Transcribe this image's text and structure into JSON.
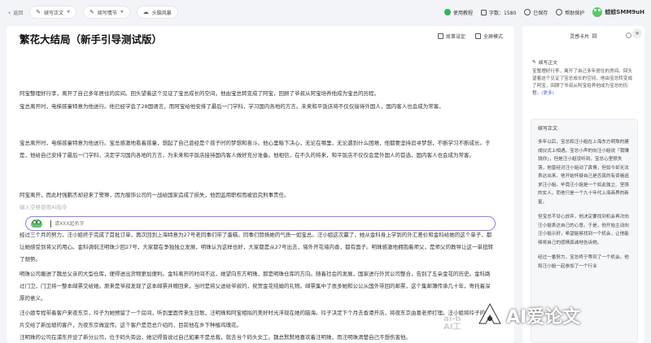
{
  "topbar": {
    "back_label": "返回",
    "pills": [
      "续写正文",
      "续写情节",
      "头脑风暴"
    ],
    "usage_label": "使用教程",
    "word_count": "字数：1580",
    "saved_label": "已保存",
    "account_label": "帮助保护",
    "username": "蛙蛙SMM9uH"
  },
  "editor": {
    "story_setting_label": "故事设定",
    "fullscreen_label": "全屏模式",
    "title": "繁花大结局（新手引导测试版）",
    "paragraphs": [
      "阿宝整理好行李，离开了自己多年居住的房间。回头望着这个见证了宝总成长的空间，他由宝总转变成了阿宝，回顾了爷叔从阿宝培养他成为宝总的历程。",
      "宝总离开时，电梯孩童特意为他送行。他已经学会了28国语言，而阿宝给他安排了最后一门学科，学习国内各地的方言。未来和平饭店将不仅仅接待外国人，国内客人也会成为常客。",
      "宝总离开时，电梯孩童特意为他送行。宝总感激地看着孩童，想起了自己曾经是个孩子时的梦想和奋斗。他心里暗下决心，无论在哪里，无论遇到什么困难，他都要坚持追寻梦想，不断学习不断成长。于是，他给自己安排了最后一门学科，决定学习国内各地的方言，为未来和平饭店接待国内客人做好充分准备。他相信，在不久的将来，和平饭店不仅仅会是外国人的首选，国内客人也会成为常客。",
      "阿宝离开，而此时强鹏杰却迎来了警察，因为服饰公司的一战给国家造成了损失，他因监用职权而被追究刑事责任。"
    ],
    "ai_placeholder_line": "输入空格使用AI指令",
    "ai_input_placeholder": "请XXX起名字",
    "lower_paragraphs": [
      "经过三个月的努力，汪小姐终于完成了首批订单，再次回到上海特意为27号老同事们带了蛋糕。同事们赞扬她的气质一如宝总。汪小姐这次赢了，她从金科身上学到的外汇差价和金科给她的这个单子，都让她感受到将父的用心。金科调侃汪明珠少回27号，大家都在争独独立发展，明珠认为这样也好，大家都是从27号出去，墙外开花墙内香，都有面子。明珠感激地拥抱着师父，是师父的教导让这一单扭转了颓势。",
      "明珠公司搬进了魏总父亲的大型仓库，便得进出货物更加便利。金科离开的时间不远，她望向东方明珠，那是明珠仓库的方向。随着社会的发展，国家进行外贸公司整合，告别了五朵金花的历史。金科路过门卫，门卫将一整本邮票交给她。原来是爷叔发现了这本邮票并赠回来，当时是将父送给爷叔的，祝贺金花结婚的礼物。邮票集中了很多她和公公从国外带回的邮票，这个集邮簿传承几十年，寄托着深厚的意义。",
      "汪小姐专程带着客户来夜东京，玲子为她预留了一个房间，听到里面传来生日歌，汪明珠和阿宝相拟的美好时光浮现在她的脑海。玲子决定下个月去香港开店，将夜东京由葛老师打理。汪小姐将玲子的名片交给了新加坡的客户，为夜东京做宣传。这个客户是范总介绍的，目前他在乡下种植鸡瑰花。",
      "汪明珠的公司在浦东开设了新分公司，位于码头旁边，她记得曾说过自己如果不是总裁，就去当个码头女工。魏总默默地喜欢着汪明珠，而汪明珠清楚自己不想伤害他。"
    ]
  },
  "panel": {
    "title": "灵感卡片",
    "card1": {
      "label": "续写正文",
      "text": "宝整理好行李，离开了自己多年居住的房间。回头望着这个见证了宝总成长的空间，他由宝总转变成了阿宝，回顾了爷叔从阿宝培养他成为宝总的历程。",
      "more": "(更多)"
    },
    "card2": {
      "label": "续写正文",
      "paragraphs": [
        "多年以后，宝总和汪小姐在上海东方明珠的建成仪式上相遇。宝总小声的向汪小姐说「我赚钱你」，但是汪小姐没听到。宝总心里很失落，他曾经对汪小姐动了真情，但如今却无法表达出来。他开始怀疑自己是否真的有资格追求汪小姐。毕竟汪小姐是一个如此独立、坚强的女人，而他只是一个九十年代上海商界的新星。",
        "但宝总不甘心放弃，他决定要找到机会再次向汪小姐表达自己的心意。于是，他开始主动向汪小姐示好，希望能够找到一个机会，让他能够将自己的感情真诚地告诉她。",
        "经过一番努力，宝总终于等到了一个机会。他和汪小姐一起参加了一个行业"
      ]
    }
  },
  "watermark": {
    "brand": "AI爱论文",
    "small_top": "ai-b",
    "small_bottom": "AI工"
  }
}
